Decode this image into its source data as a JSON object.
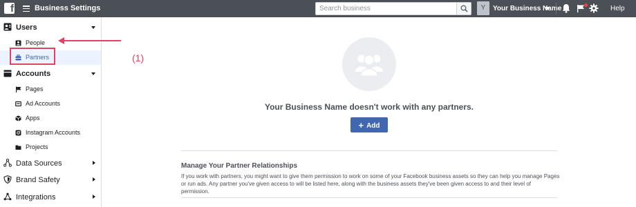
{
  "topbar": {
    "logo": "f",
    "title": "Business Settings",
    "search_placeholder": "Search business",
    "business_initial": "Y",
    "business_name": "Your Business Name",
    "help": "Help",
    "icons": [
      "facebook-logo",
      "hamburger-icon",
      "search-icon",
      "caret-down-icon",
      "bell-icon",
      "flag-icon",
      "gear-icon"
    ],
    "notification_dot_color": "#fa3e3e"
  },
  "sidebar": {
    "sections": [
      {
        "label": "Users",
        "icon": "users-icon",
        "expanded": true,
        "items": [
          {
            "label": "People",
            "icon": "person-card-icon"
          },
          {
            "label": "Partners",
            "icon": "briefcase-icon",
            "selected": true
          }
        ]
      },
      {
        "label": "Accounts",
        "icon": "accounts-icon",
        "expanded": true,
        "items": [
          {
            "label": "Pages",
            "icon": "flag-icon"
          },
          {
            "label": "Ad Accounts",
            "icon": "ad-icon"
          },
          {
            "label": "Apps",
            "icon": "cube-icon"
          },
          {
            "label": "Instagram Accounts",
            "icon": "camera-icon"
          },
          {
            "label": "Projects",
            "icon": "folder-icon"
          }
        ]
      },
      {
        "label": "Data Sources",
        "icon": "nodes-icon",
        "expanded": false
      },
      {
        "label": "Brand Safety",
        "icon": "shield-icon",
        "expanded": false
      },
      {
        "label": "Integrations",
        "icon": "share-icon",
        "expanded": false
      }
    ]
  },
  "annotation": {
    "label": "(1)",
    "color": "#e4405f"
  },
  "main": {
    "empty_title": "Your Business Name doesn't work with any partners.",
    "add_label": "Add",
    "add_icon": "+",
    "manage_title": "Manage Your Partner Relationships",
    "manage_text": "If you work with partners, you might want to give them permission to work on some of your Facebook business assets so they can help you manage Pages or run ads. Any partner you've given access to will be listed here, along with the business assets they've been given access to and their level of permission."
  },
  "colors": {
    "topbar": "#4b4f56",
    "accent": "#4267b2",
    "selected_bg": "#eaf3ff"
  }
}
